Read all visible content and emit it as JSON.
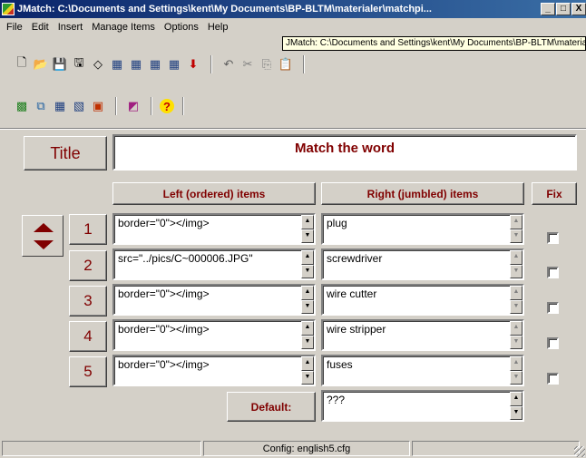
{
  "window": {
    "title": "JMatch: C:\\Documents and Settings\\kent\\My Documents\\BP-BLTM\\materialer\\matchpi...",
    "min": "_",
    "max": "□",
    "close": "X"
  },
  "menu": [
    "File",
    "Edit",
    "Insert",
    "Manage Items",
    "Options",
    "Help"
  ],
  "tooltip": "JMatch: C:\\Documents and Settings\\kent\\My Documents\\BP-BLTM\\materialer\\matchpi",
  "toolbar1": {
    "icons": [
      "new-file-icon",
      "open-folder-icon",
      "save-icon",
      "save-as-icon",
      "eraser-icon",
      "web-export-1-icon",
      "web-export-2-icon",
      "web-export-3-icon",
      "web-export-4-icon",
      "arrow-down-icon"
    ],
    "icons2": [
      "undo-icon",
      "cut-icon",
      "copy-icon",
      "paste-icon"
    ],
    "glyphs": [
      "🗋",
      "📂",
      "💾",
      "🖫",
      "◇",
      "▦",
      "▦",
      "▦",
      "▦",
      "⬇"
    ],
    "glyphs2": [
      "↶",
      "✂",
      "⎘",
      "📋"
    ]
  },
  "toolbar2": {
    "icons": [
      "image-icon",
      "windows-icon",
      "grid-icon",
      "grid-alt-icon",
      "flag-icon",
      "media-icon",
      "help-icon"
    ],
    "glyphs": [
      "▩",
      "⧉",
      "▦",
      "▧",
      "▣",
      "◩",
      "?"
    ]
  },
  "title_label": "Title",
  "title_value": "Match the word",
  "headers": {
    "left": "Left (ordered) items",
    "right": "Right (jumbled) items",
    "fix": "Fix"
  },
  "rows": [
    {
      "num": "1",
      "left": "border=\"0\"></img>",
      "right": "plug"
    },
    {
      "num": "2",
      "left": "src=\"../pics/C~000006.JPG\"",
      "right": "screwdriver"
    },
    {
      "num": "3",
      "left": "border=\"0\"></img>",
      "right": "wire cutter"
    },
    {
      "num": "4",
      "left": "border=\"0\"></img>",
      "right": "wire stripper"
    },
    {
      "num": "5",
      "left": "border=\"0\"></img>",
      "right": "fuses"
    }
  ],
  "default_label": "Default:",
  "default_value": "???",
  "status": {
    "config": "Config: english5.cfg"
  },
  "colors": {
    "accent": "#800000",
    "titlebar": "#0a246a",
    "face": "#d4d0c8"
  }
}
